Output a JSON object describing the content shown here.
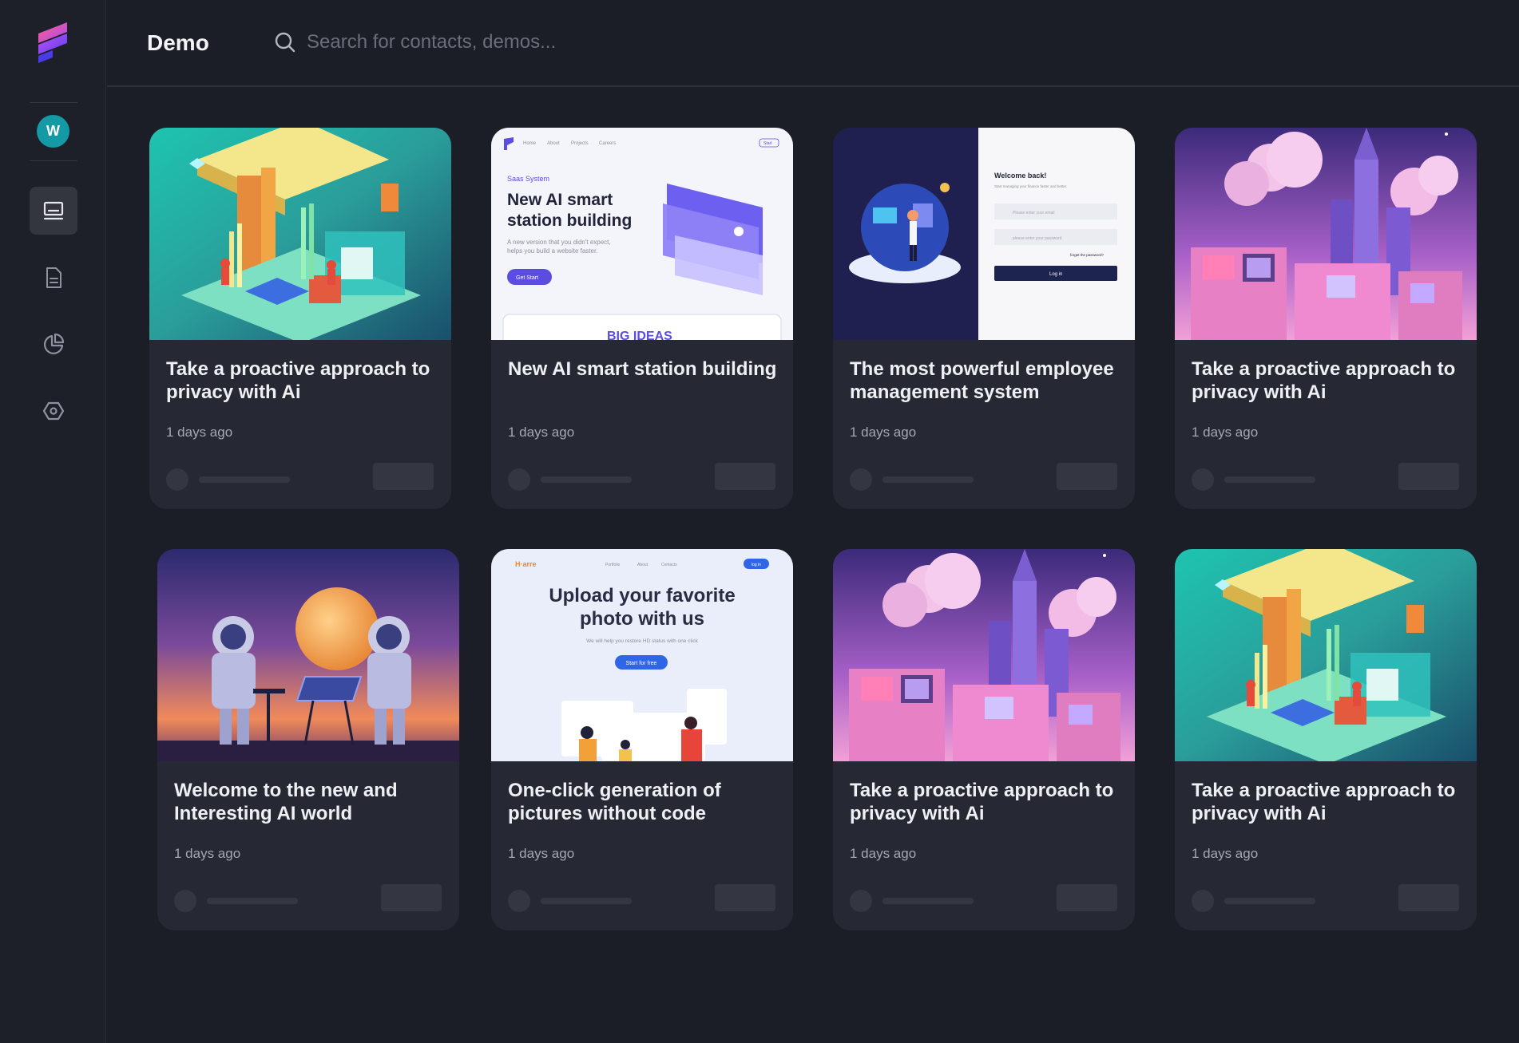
{
  "header": {
    "title": "Demo",
    "search_placeholder": "Search for contacts, demos..."
  },
  "sidebar": {
    "avatar_initial": "W",
    "items": [
      {
        "icon": "monitor-icon",
        "active": true
      },
      {
        "icon": "document-icon",
        "active": false
      },
      {
        "icon": "pie-chart-icon",
        "active": false
      },
      {
        "icon": "settings-hexagon-icon",
        "active": false
      }
    ]
  },
  "colors": {
    "background": "#1b1d27",
    "card": "#262833",
    "avatar": "#139aa5",
    "accent": "#5b4de0"
  },
  "cards": [
    {
      "title": "Take a proactive approach to privacy with Ai",
      "meta": "1 days ago",
      "thumb": "isometric-teal"
    },
    {
      "title": "New AI smart station building",
      "meta": "1 days ago",
      "thumb": "saas-landing",
      "thumb_text": {
        "nav": [
          "Home",
          "About",
          "Projects",
          "Careers"
        ],
        "nav_button": "Start",
        "kicker": "Saas System",
        "headline_1": "New AI smart",
        "headline_2": "station building",
        "sub_1": "A new version that you didn't expect,",
        "sub_2": "helps you build a website faster.",
        "cta": "Get Start",
        "banner": "BIG IDEAS"
      }
    },
    {
      "title": "The most powerful employee management system",
      "meta": "1 days ago",
      "thumb": "login-screen",
      "thumb_text": {
        "heading": "Welcome back!",
        "sub": "Start managing your finance faster and better.",
        "email_placeholder": "Please enter your email",
        "password_placeholder": "please enter your password",
        "forgot": "forget the password?",
        "login": "Log in"
      }
    },
    {
      "title": "Take a proactive approach to privacy with Ai",
      "meta": "1 days ago",
      "thumb": "pink-city"
    },
    {
      "title": "Welcome to the new and Interesting AI world",
      "meta": "1 days ago",
      "thumb": "astronauts"
    },
    {
      "title": "One-click generation of pictures without code",
      "meta": "1 days ago",
      "thumb": "upload-landing",
      "thumb_text": {
        "brand": "H·arre",
        "nav": [
          "Portfolio",
          "About",
          "Contacts"
        ],
        "nav_button": "log in",
        "headline_1": "Upload your favorite",
        "headline_2": "photo with us",
        "sub": "We will help you restore HD status with one click",
        "cta": "Start for free"
      }
    },
    {
      "title": "Take a proactive approach to privacy with Ai",
      "meta": "1 days ago",
      "thumb": "pink-city"
    },
    {
      "title": "Take a proactive approach to privacy with Ai",
      "meta": "1 days ago",
      "thumb": "isometric-teal"
    }
  ]
}
